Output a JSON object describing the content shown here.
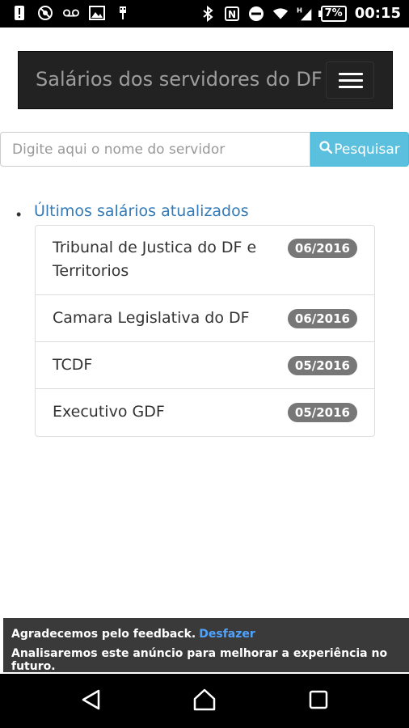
{
  "status_bar": {
    "battery": "7%",
    "time": "00:15",
    "network": "H"
  },
  "navbar": {
    "brand": "Salários dos servidores do DF"
  },
  "search": {
    "placeholder": "Digite aqui o nome do servidor",
    "button_label": "Pesquisar"
  },
  "section": {
    "title": "Últimos salários atualizados",
    "items": [
      {
        "label": "Tribunal de Justica do DF e Territorios",
        "date": "06/2016"
      },
      {
        "label": "Camara Legislativa do DF",
        "date": "06/2016"
      },
      {
        "label": "TCDF",
        "date": "05/2016"
      },
      {
        "label": "Executivo GDF",
        "date": "05/2016"
      }
    ]
  },
  "snackbar": {
    "title": "Agradecemos pelo feedback.",
    "action": "Desfazer",
    "message": "Analisaremos este anúncio para melhorar a experiência no futuro."
  },
  "icons": [
    "warning-icon",
    "no-camera-icon",
    "voicemail-icon",
    "image-icon",
    "usb-icon",
    "bluetooth-icon",
    "nfc-icon",
    "do-not-disturb-icon",
    "wifi-icon",
    "signal-icon",
    "battery-icon",
    "search-icon",
    "hamburger-icon",
    "back-icon",
    "home-icon",
    "recents-icon"
  ]
}
